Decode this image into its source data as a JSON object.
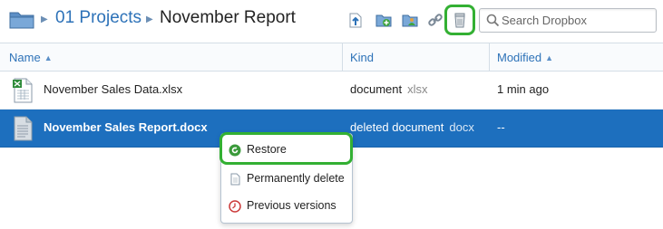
{
  "header": {
    "breadcrumb": {
      "parent": "01 Projects",
      "current": "November Report"
    },
    "toolbar": {
      "icons": [
        "upload-icon",
        "new-folder-icon",
        "share-folder-icon",
        "share-link-icon",
        "show-deleted-files-icon"
      ],
      "highlight_color": "#33b033"
    },
    "search": {
      "placeholder": "Search Dropbox",
      "value": ""
    }
  },
  "columns": [
    {
      "label": "Name",
      "sorted": true
    },
    {
      "label": "Kind",
      "sorted": false
    },
    {
      "label": "Modified",
      "sorted": true
    }
  ],
  "sort_arrow": "▲",
  "files": [
    {
      "name": "November Sales Data.xlsx",
      "kind": "document",
      "ext": "xlsx",
      "modified": "1 min ago",
      "icon": "excel-file-icon",
      "selected": false
    },
    {
      "name": "November Sales Report.docx",
      "kind": "deleted document",
      "ext": "docx",
      "modified": "--",
      "icon": "deleted-document-icon",
      "selected": true
    }
  ],
  "context_menu": {
    "items": [
      {
        "label": "Restore",
        "icon": "restore-icon"
      },
      {
        "label": "Permanently delete",
        "icon": "permanently-delete-icon"
      },
      {
        "label": "Previous versions",
        "icon": "previous-versions-icon"
      }
    ]
  },
  "colors": {
    "link": "#2d72b8",
    "selection": "#1d6fbe",
    "highlight": "#33b033"
  }
}
